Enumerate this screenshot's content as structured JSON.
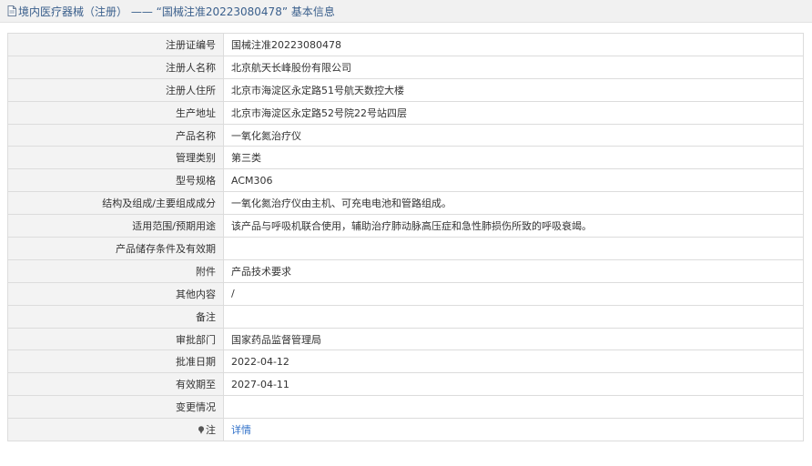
{
  "header": {
    "icon": "document-icon",
    "title": "境内医疗器械（注册） —— “国械注准20223080478” 基本信息"
  },
  "rows": [
    {
      "key": "reg-no",
      "label": "注册证编号",
      "value": "国械注准20223080478"
    },
    {
      "key": "registrant-name",
      "label": "注册人名称",
      "value": "北京航天长峰股份有限公司"
    },
    {
      "key": "registrant-address",
      "label": "注册人住所",
      "value": "北京市海淀区永定路51号航天数控大楼"
    },
    {
      "key": "production-address",
      "label": "生产地址",
      "value": "北京市海淀区永定路52号院22号站四层"
    },
    {
      "key": "product-name",
      "label": "产品名称",
      "value": "一氧化氮治疗仪"
    },
    {
      "key": "management-class",
      "label": "管理类别",
      "value": "第三类"
    },
    {
      "key": "model-spec",
      "label": "型号规格",
      "value": "ACM306"
    },
    {
      "key": "structure",
      "label": "结构及组成/主要组成成分",
      "value": "一氧化氮治疗仪由主机、可充电电池和管路组成。"
    },
    {
      "key": "scope",
      "label": "适用范围/预期用途",
      "value": "该产品与呼吸机联合使用，辅助治疗肺动脉高压症和急性肺损伤所致的呼吸衰竭。"
    },
    {
      "key": "storage",
      "label": "产品储存条件及有效期",
      "value": ""
    },
    {
      "key": "attachment",
      "label": "附件",
      "value": "产品技术要求"
    },
    {
      "key": "other",
      "label": "其他内容",
      "value": "/"
    },
    {
      "key": "remarks",
      "label": "备注",
      "value": ""
    },
    {
      "key": "approval-dept",
      "label": "审批部门",
      "value": "国家药品监督管理局"
    },
    {
      "key": "approval-date",
      "label": "批准日期",
      "value": "2022-04-12"
    },
    {
      "key": "valid-until",
      "label": "有效期至",
      "value": "2027-04-11"
    },
    {
      "key": "change-status",
      "label": "变更情况",
      "value": ""
    },
    {
      "key": "note",
      "label": "注",
      "value": "详情",
      "icon": "pin-icon",
      "link": true
    }
  ],
  "colors": {
    "title": "#3a5f8c",
    "link": "#2f70c9",
    "label_bg": "#f3f3f3",
    "border": "#dcdcdc"
  }
}
